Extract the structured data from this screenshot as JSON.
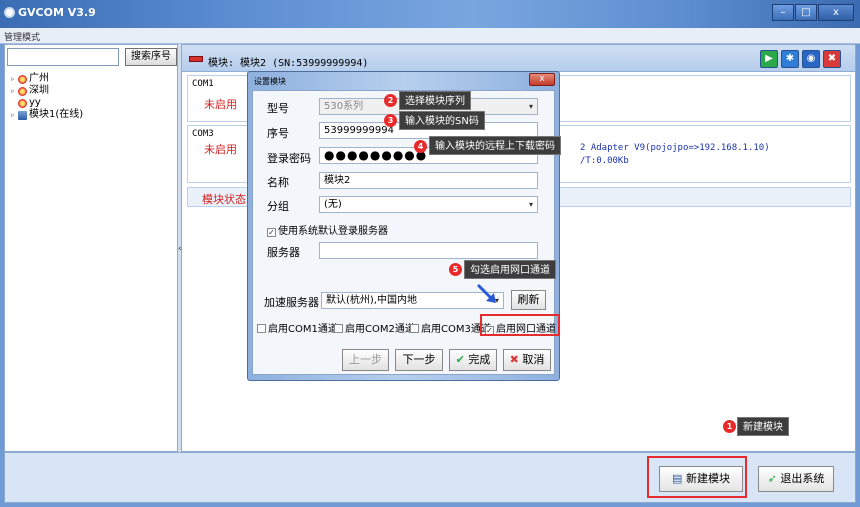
{
  "app": {
    "title": "GVCOM V3.9",
    "menu_label": "管理模式"
  },
  "window_buttons": {
    "minimize": "–",
    "maximize": "□",
    "close": "x"
  },
  "left_panel": {
    "search_value": "",
    "search_button": "搜索序号",
    "tree": [
      {
        "label": "广州",
        "type": "group"
      },
      {
        "label": "深圳",
        "type": "group"
      },
      {
        "label": "yy",
        "type": "group"
      },
      {
        "label": "模块1(在线)",
        "type": "module"
      }
    ]
  },
  "main": {
    "header_title": "模块: 模块2 (SN:53999999994)",
    "toolbar": [
      {
        "name": "play",
        "glyph": "▶",
        "color": "#2aa84a"
      },
      {
        "name": "settings",
        "glyph": "✱",
        "color": "#2f7dd6"
      },
      {
        "name": "globe",
        "glyph": "◉",
        "color": "#2a66c4"
      },
      {
        "name": "delete",
        "glyph": "✖",
        "color": "#d83a3a"
      }
    ],
    "com1": {
      "title": "COM1",
      "status": "未启用"
    },
    "com3": {
      "title": "COM3",
      "status": "未启用",
      "info_line1": "2 Adapter V9(pojojpo=>192.168.1.10)",
      "info_line2": "/T:0.00Kb"
    },
    "module_status_label": "模块状态:"
  },
  "dialog": {
    "title": "设置模块",
    "close_glyph": "x",
    "model_label": "型号",
    "model_value": "530系列",
    "serial_label": "序号",
    "serial_value": "53999999994",
    "password_label": "登录密码",
    "password_mask": "●●●●●●●●●",
    "name_label": "名称",
    "name_value": "模块2",
    "group_label": "分组",
    "group_value": "(无)",
    "use_default_server": "使用系统默认登录服务器",
    "server_label": "服务器",
    "server_value": "",
    "accel_label": "加速服务器",
    "accel_value": "默认(杭州),中国内地",
    "refresh_button": "刷新",
    "channels": [
      {
        "label": "启用COM1通道",
        "checked": false
      },
      {
        "label": "启用COM2通道",
        "checked": false
      },
      {
        "label": "启用COM3通道",
        "checked": false
      },
      {
        "label": "启用网口通道",
        "checked": true
      }
    ],
    "prev_button": "上一步",
    "next_button": "下一步",
    "finish_button": "完成",
    "cancel_button": "取消"
  },
  "annotations": [
    {
      "number": "1",
      "text": "新建模块"
    },
    {
      "number": "2",
      "text": "选择模块序列"
    },
    {
      "number": "3",
      "text": "输入模块的SN码"
    },
    {
      "number": "4",
      "text": "输入模块的远程上下载密码"
    },
    {
      "number": "5",
      "text": "勾选启用网口通道"
    }
  ],
  "bottom": {
    "new_module": "新建模块",
    "exit": "退出系统"
  },
  "colors": {
    "accent_red": "#e52b2b",
    "titlebar_blue": "#5f90d4",
    "status_red": "#d22222"
  }
}
